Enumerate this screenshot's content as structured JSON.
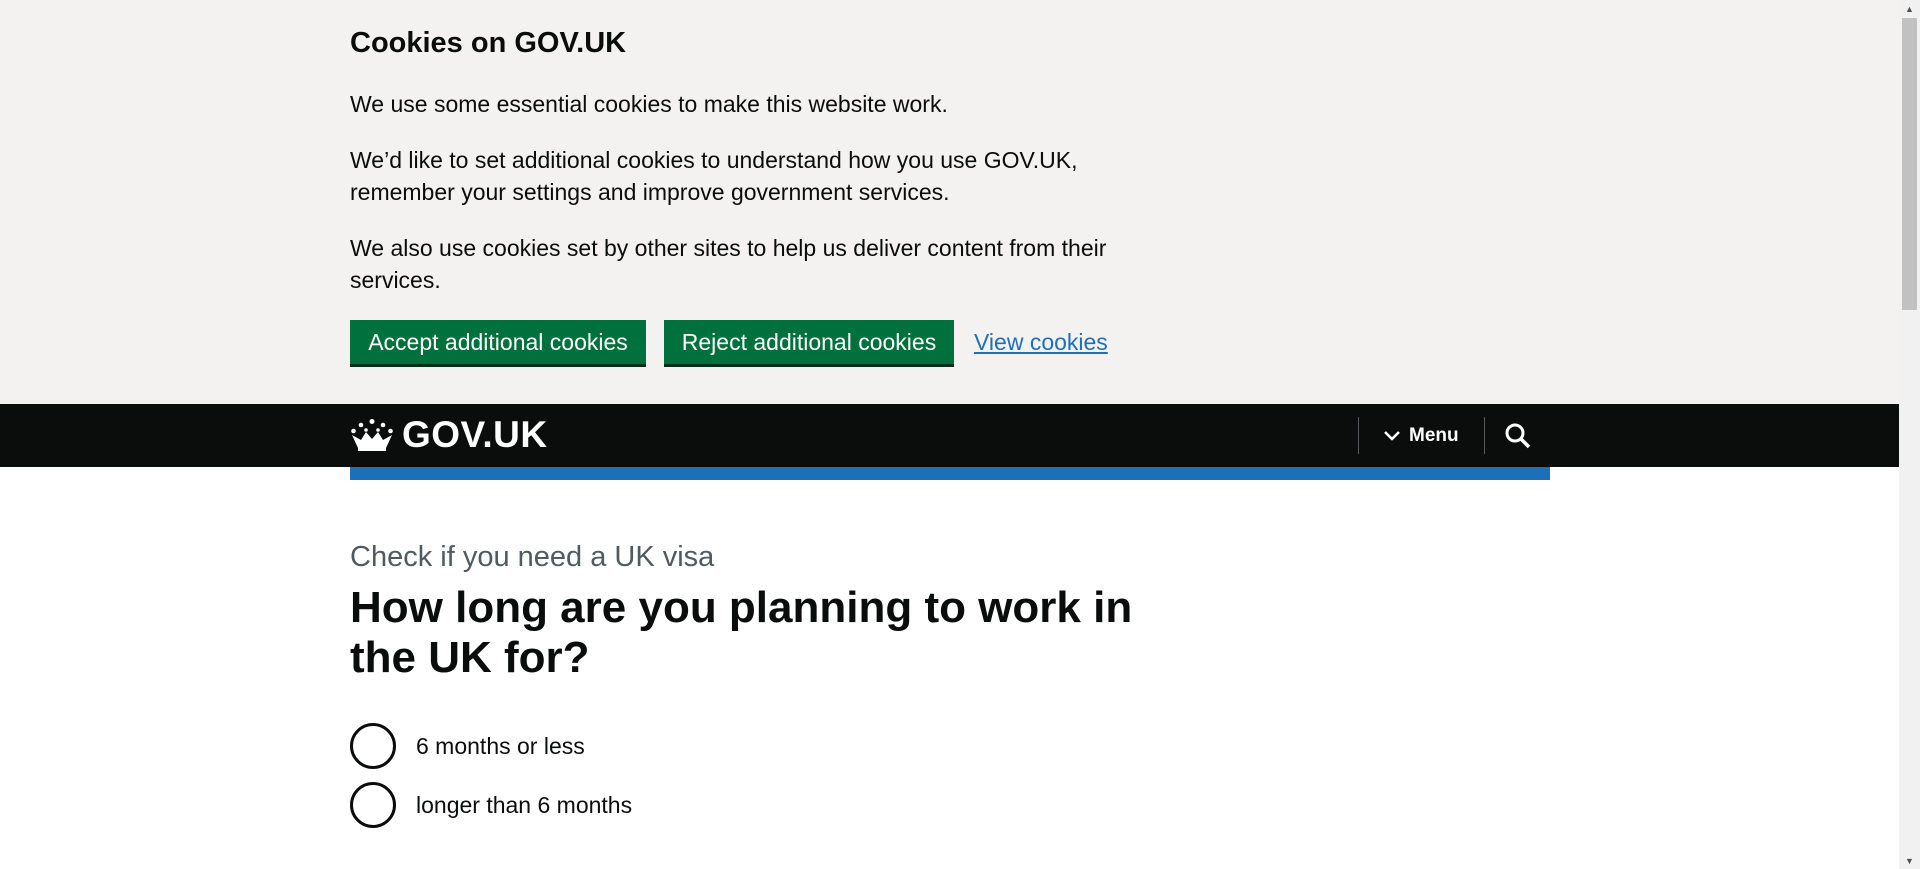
{
  "cookie_banner": {
    "heading": "Cookies on GOV.UK",
    "paragraphs": [
      "We use some essential cookies to make this website work.",
      "We’d like to set additional cookies to understand how you use GOV.UK, remember your settings and improve government services.",
      "We also use cookies set by other sites to help us deliver content from their services."
    ],
    "accept_label": "Accept additional cookies",
    "reject_label": "Reject additional cookies",
    "view_label": "View cookies"
  },
  "header": {
    "logo_text": "GOV.UK",
    "menu_label": "Menu",
    "logo_icon": "crown-icon",
    "menu_icon": "chevron-down-icon",
    "search_icon": "search-icon"
  },
  "main": {
    "caption": "Check if you need a UK visa",
    "title": "How long are you planning to work in the UK for?",
    "options": [
      {
        "label": "6 months or less",
        "selected": false
      },
      {
        "label": "longer than 6 months",
        "selected": false
      }
    ]
  },
  "colors": {
    "button_green": "#00703c",
    "link_blue": "#1d70b8",
    "header_black": "#0b0c0c",
    "banner_grey": "#f3f2f1"
  }
}
